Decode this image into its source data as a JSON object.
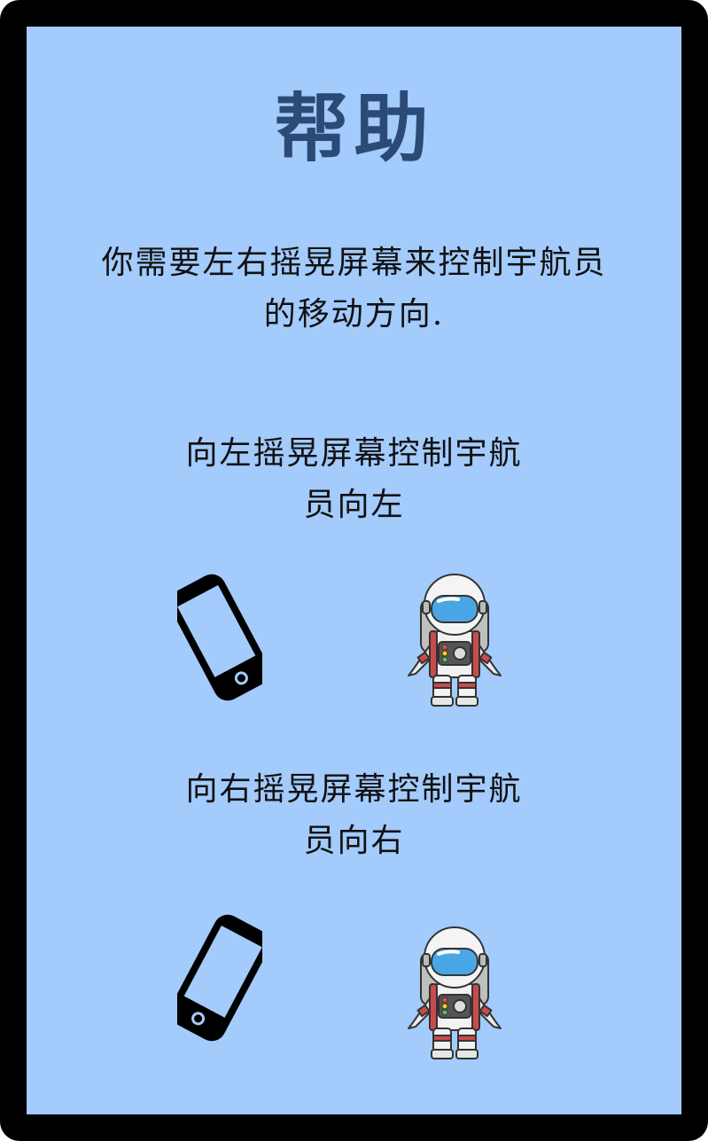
{
  "help": {
    "title": "帮助",
    "intro_line1": "你需要左右摇晃屏幕来控制宇航员",
    "intro_line2": "的移动方向.",
    "left_caption_line1": "向左摇晃屏幕控制宇航",
    "left_caption_line2": "员向左",
    "right_caption_line1": "向右摇晃屏幕控制宇航",
    "right_caption_line2": "员向右"
  },
  "icons": {
    "phone_tilt_left": "phone-icon",
    "phone_tilt_right": "phone-icon",
    "astronaut": "astronaut-icon"
  },
  "colors": {
    "frame": "#000000",
    "panel": "#a3cbfc",
    "title": "#2b4a76",
    "text": "#111111",
    "visor": "#4aa7e6",
    "suit_accent": "#c94b4b"
  }
}
